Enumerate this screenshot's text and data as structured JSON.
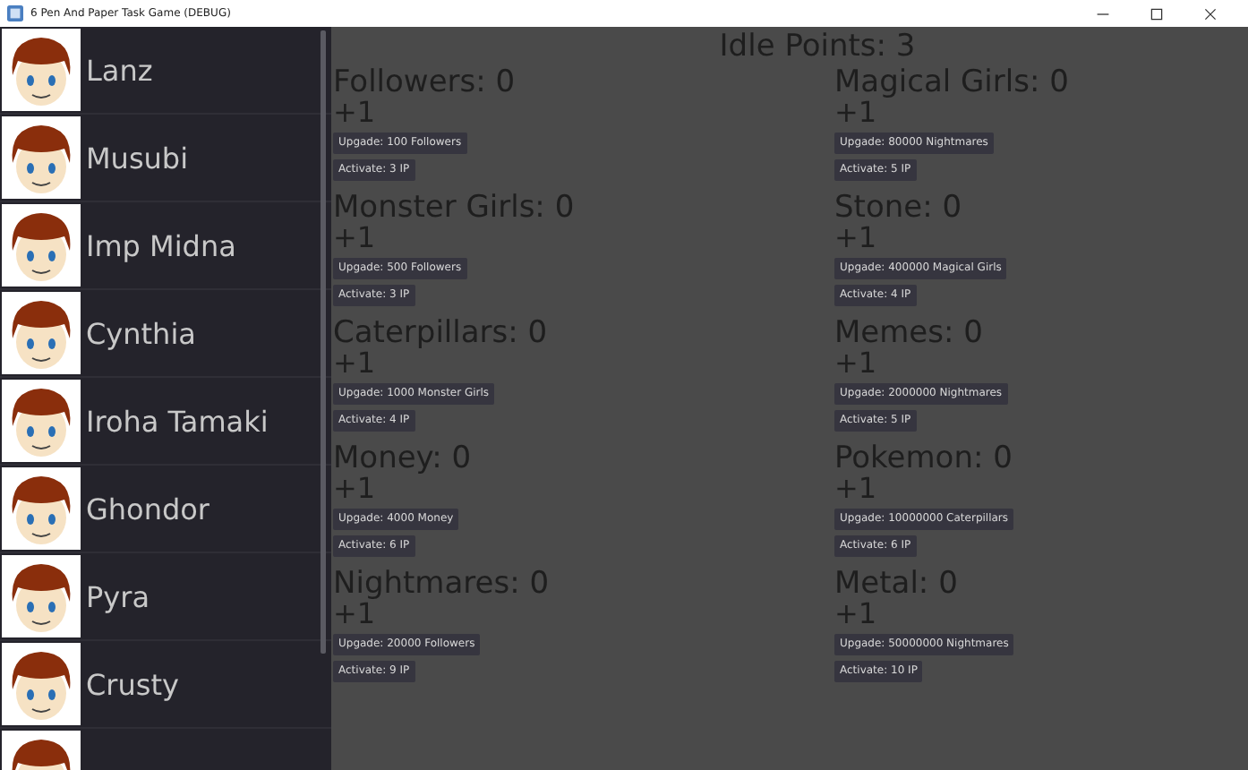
{
  "window": {
    "title": "6 Pen And Paper Task Game (DEBUG)"
  },
  "sidebar": {
    "items": [
      {
        "name": "Lanz"
      },
      {
        "name": "Musubi"
      },
      {
        "name": "Imp Midna"
      },
      {
        "name": "Cynthia"
      },
      {
        "name": "Iroha Tamaki"
      },
      {
        "name": "Ghondor"
      },
      {
        "name": "Pyra"
      },
      {
        "name": "Crusty"
      }
    ]
  },
  "idle_points": "Idle Points: 3",
  "resources": [
    {
      "title": "Followers: 0",
      "gain": "+1",
      "upgrade": "Upgade: 100 Followers",
      "activate": "Activate: 3 IP"
    },
    {
      "title": "Magical Girls: 0",
      "gain": "+1",
      "upgrade": "Upgade: 80000 Nightmares",
      "activate": "Activate: 5 IP"
    },
    {
      "title": "Monster Girls: 0",
      "gain": "+1",
      "upgrade": "Upgade: 500 Followers",
      "activate": "Activate: 3 IP"
    },
    {
      "title": "Stone: 0",
      "gain": "+1",
      "upgrade": "Upgade: 400000 Magical Girls",
      "activate": "Activate: 4 IP"
    },
    {
      "title": "Caterpillars: 0",
      "gain": "+1",
      "upgrade": "Upgade: 1000 Monster Girls",
      "activate": "Activate: 4 IP"
    },
    {
      "title": "Memes: 0",
      "gain": "+1",
      "upgrade": "Upgade: 2000000 Nightmares",
      "activate": "Activate: 5 IP"
    },
    {
      "title": "Money: 0",
      "gain": "+1",
      "upgrade": "Upgade: 4000 Money",
      "activate": "Activate: 6 IP"
    },
    {
      "title": "Pokemon: 0",
      "gain": "+1",
      "upgrade": "Upgade: 10000000 Caterpillars",
      "activate": "Activate: 6 IP"
    },
    {
      "title": "Nightmares: 0",
      "gain": "+1",
      "upgrade": "Upgade: 20000 Followers",
      "activate": "Activate: 9 IP"
    },
    {
      "title": "Metal: 0",
      "gain": "+1",
      "upgrade": "Upgade: 50000000 Nightmares",
      "activate": "Activate: 10 IP"
    }
  ]
}
